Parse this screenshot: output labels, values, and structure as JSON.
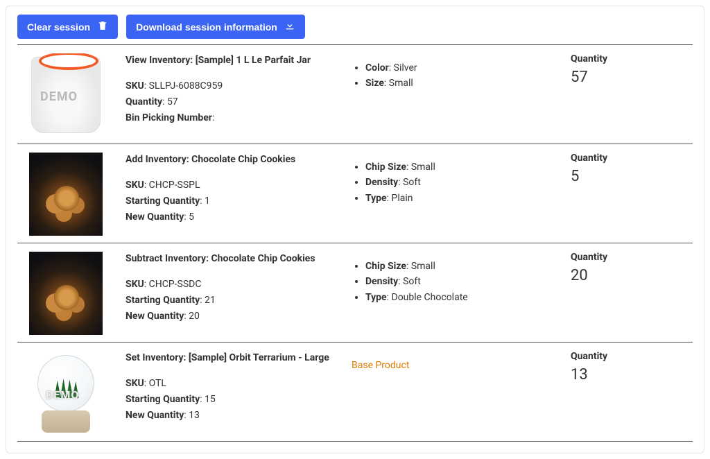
{
  "toolbar": {
    "clear_label": "Clear session",
    "download_label": "Download session information"
  },
  "labels": {
    "sku": "SKU",
    "quantity_inline": "Quantity",
    "bin": "Bin Picking Number",
    "starting_qty": "Starting Quantity",
    "new_qty": "New Quantity",
    "quantity": "Quantity",
    "base_product": "Base Product"
  },
  "rows": [
    {
      "title": "View Inventory: [Sample] 1 L Le Parfait Jar",
      "sku": "SLLPJ-6088C959",
      "quantity_inline": "57",
      "bin": "",
      "attrs": [
        {
          "k": "Color",
          "v": "Silver"
        },
        {
          "k": "Size",
          "v": "Small"
        }
      ],
      "qty": "57"
    },
    {
      "title": "Add Inventory: Chocolate Chip Cookies",
      "sku": "CHCP-SSPL",
      "start": "1",
      "new": "5",
      "attrs": [
        {
          "k": "Chip Size",
          "v": "Small"
        },
        {
          "k": "Density",
          "v": "Soft"
        },
        {
          "k": "Type",
          "v": "Plain"
        }
      ],
      "qty": "5"
    },
    {
      "title": "Subtract Inventory: Chocolate Chip Cookies",
      "sku": "CHCP-SSDC",
      "start": "21",
      "new": "20",
      "attrs": [
        {
          "k": "Chip Size",
          "v": "Small"
        },
        {
          "k": "Density",
          "v": "Soft"
        },
        {
          "k": "Type",
          "v": "Double Chocolate"
        }
      ],
      "qty": "20"
    },
    {
      "title": "Set Inventory: [Sample] Orbit Terrarium - Large",
      "sku": "OTL",
      "start": "15",
      "new": "13",
      "base_product": true,
      "qty": "13"
    }
  ]
}
